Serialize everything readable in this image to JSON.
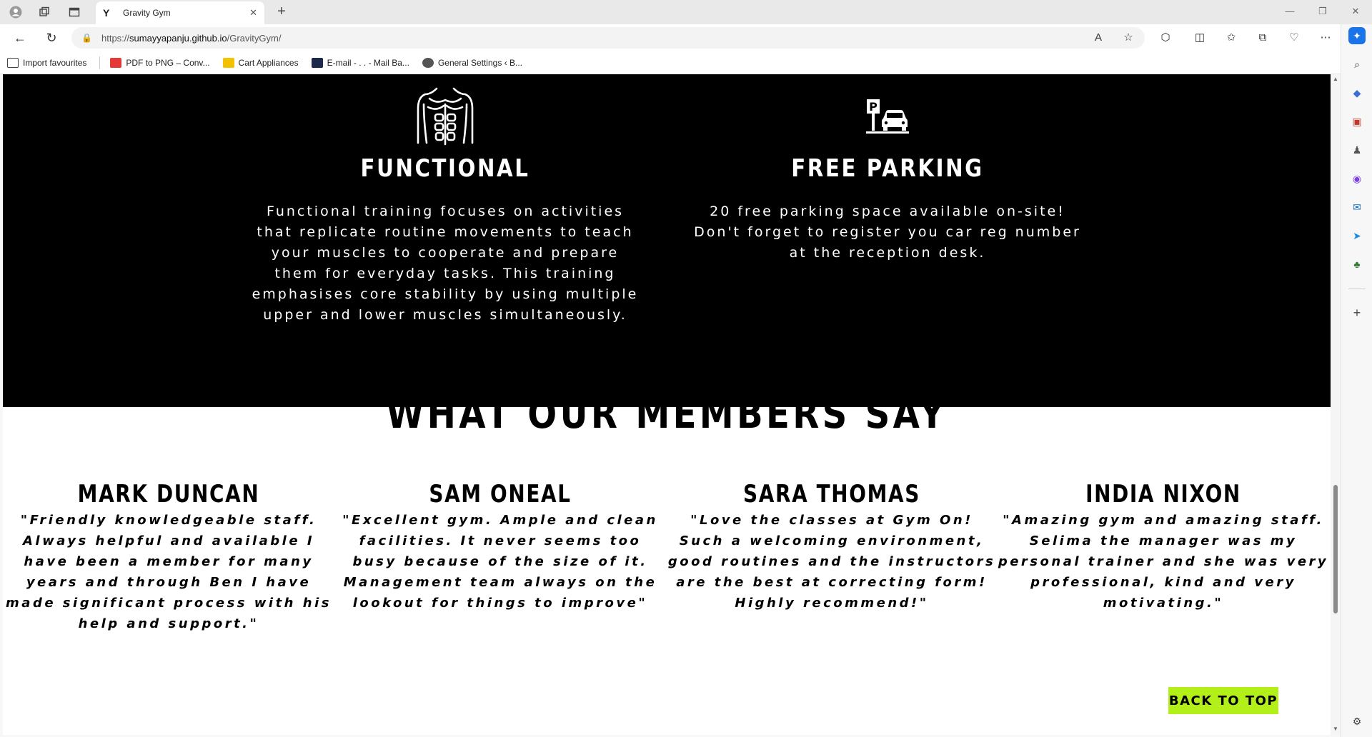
{
  "browser": {
    "tab_title": "Gravity Gym",
    "tab_favicon": "Y",
    "url_prefix": "https://",
    "url_host": "sumayyapanju.github.io",
    "url_path": "/GravityGym/",
    "bookmarks": [
      "Import favourites",
      "PDF to PNG – Conv...",
      "Cart Appliances",
      "E-mail - . . - Mail Ba...",
      "General Settings ‹ B..."
    ]
  },
  "features": [
    {
      "title": "FUNCTIONAL",
      "text": "Functional training focuses on activities that replicate routine movements to teach your muscles to cooperate and prepare them for everyday tasks. This training emphasises core stability by using multiple upper and lower muscles simultaneously."
    },
    {
      "title": "FREE PARKING",
      "text": "20 free parking space available on-site! Don't forget to register you car reg number at the reception desk."
    }
  ],
  "testimonials": {
    "title": "WHAT OUR MEMBERS SAY",
    "items": [
      {
        "name": "MARK DUNCAN",
        "quote": "\"Friendly knowledgeable staff. Always helpful and available I have been a member for many years and through Ben I have made significant process with his help and support.\""
      },
      {
        "name": "SAM ONEAL",
        "quote": "\"Excellent gym. Ample and clean facilities. It never seems too busy because of the size of it. Management team always on the lookout for things to improve\""
      },
      {
        "name": "SARA THOMAS",
        "quote": "\"Love the classes at Gym On! Such a welcoming environment, good routines and the instructors are the best at correcting form! Highly recommend!\""
      },
      {
        "name": "INDIA NIXON",
        "quote": "\"Amazing gym and amazing staff. Selima the manager was my personal trainer and she was very professional, kind and very motivating.\""
      }
    ]
  },
  "back_to_top": "BACK TO TOP",
  "colors": {
    "accent": "#b3f01a",
    "dark": "#000000",
    "light": "#ffffff"
  }
}
